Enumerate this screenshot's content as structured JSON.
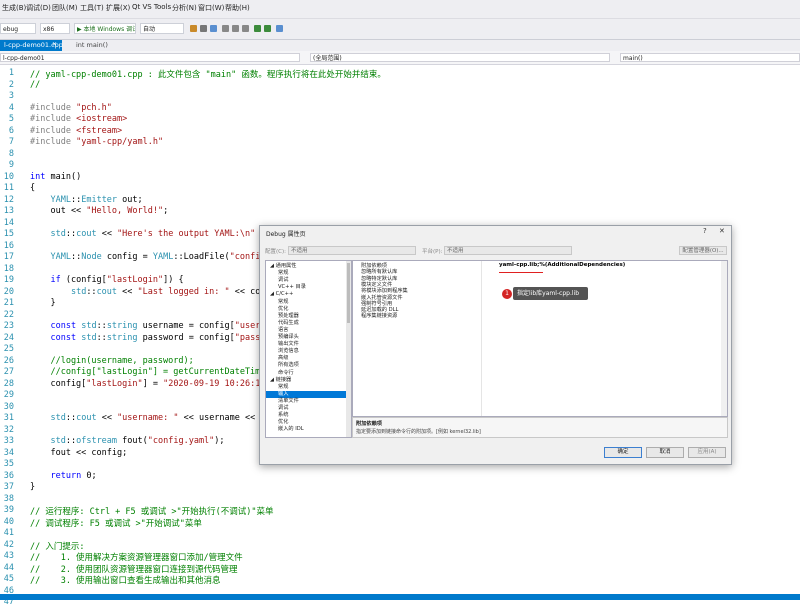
{
  "menu": {
    "items": [
      "生成(B)",
      "调试(D)",
      "团队(M)",
      "工具(T)",
      "扩展(X)",
      "Qt VS Tools",
      "分析(N)",
      "窗口(W)",
      "帮助(H)"
    ]
  },
  "toolbar": {
    "config": "ebug",
    "platform": "x86",
    "debugger": "▶ 本地 Windows 调试器",
    "mode": "自动"
  },
  "tabs": {
    "active": "l-cpp-demo01.cpp",
    "secondary": "int main()"
  },
  "nav": {
    "project": "l-cpp-demo01",
    "scope": "(全局范围)",
    "function": "main()"
  },
  "editor": {
    "line_numbers": [
      "1",
      "2",
      "3",
      "4",
      "5",
      "6",
      "7",
      "8",
      "9",
      "10",
      "11",
      "12",
      "13",
      "14",
      "15",
      "16",
      "17",
      "18",
      "19",
      "20",
      "21",
      "22",
      "23",
      "24",
      "25",
      "26",
      "27",
      "28",
      "29",
      "30",
      "31",
      "32",
      "33",
      "34",
      "35",
      "36",
      "37",
      "38",
      "39",
      "40",
      "41",
      "42",
      "43",
      "44",
      "45",
      "46",
      "47"
    ],
    "lines": [
      "// yaml-cpp-demo01.cpp : 此文件包含 \"main\" 函数。程序执行将在此处开始并结束。",
      "//",
      "",
      "#include \"pch.h\"",
      "#include <iostream>",
      "#include <fstream>",
      "#include \"yaml-cpp/yaml.h\"",
      "",
      "",
      "int main()",
      "{",
      "    YAML::Emitter out;",
      "    out << \"Hello, World!\";",
      "",
      "    std::cout << \"Here's the output YAML:\\n\" << out.c_str();",
      "",
      "    YAML::Node config = YAML::LoadFile(\"config.yaml\");",
      "",
      "    if (config[\"lastLogin\"]) {",
      "        std::cout << \"Last logged in: \" << config[\"lastLogin\"]",
      "    }",
      "",
      "    const std::string username = config[\"username\"].as<std::string>();",
      "    const std::string password = config[\"password\"].as<std::string>();",
      "",
      "    //login(username, password);",
      "    //config[\"lastLogin\"] = getCurrentDateTime();",
      "    config[\"lastLogin\"] = \"2020-09-19 10:26:10\";",
      "",
      "",
      "    std::cout << \"username: \" << username << std::endl;",
      "",
      "    std::ofstream fout(\"config.yaml\");",
      "    fout << config;",
      "",
      "    return 0;",
      "}",
      "",
      "// 运行程序: Ctrl + F5 或调试 >\"开始执行(不调试)\"菜单",
      "// 调试程序: F5 或调试 >\"开始调试\"菜单",
      "",
      "// 入门提示:",
      "//    1. 使用解决方案资源管理器窗口添加/管理文件",
      "//    2. 使用团队资源管理器窗口连接到源代码管理",
      "//    3. 使用输出窗口查看生成输出和其他消息",
      "",
      ""
    ]
  },
  "dialog": {
    "title": "Debug 属性页",
    "help": "?",
    "close": "✕",
    "config_label": "配置(C):",
    "config_value": "不适用",
    "platform_label": "平台(P):",
    "platform_value": "不适用",
    "manager_button": "配置管理器(O)...",
    "tree": [
      "◢ 通用属性",
      "常规",
      "调试",
      "VC++ 目录",
      "◢ C/C++",
      "常规",
      "优化",
      "预处理器",
      "代码生成",
      "语言",
      "预编译头",
      "输出文件",
      "浏览信息",
      "高级",
      "所有选项",
      "命令行",
      "◢ 链接器",
      "常规",
      "输入",
      "清单文件",
      "调试",
      "系统",
      "优化",
      "嵌入的 IDL"
    ],
    "selected_index": 18,
    "grid_rows": [
      "附加依赖项",
      "忽略所有默认库",
      "忽略特定默认库",
      "模块定义文件",
      "将模块添加到程序集",
      "嵌入托管资源文件",
      "强制符号引用",
      "延迟加载的 DLL",
      "程序集链接资源"
    ],
    "grid_value": "yaml-cpp.lib;%(AdditionalDependencies)",
    "callout_number": "1",
    "callout_text": "指定lib库yaml-cpp.lib",
    "desc_title": "附加依赖项",
    "desc_text": "指定要添加到链接命令行的附加项。[例如 kernel32.lib]",
    "ok": "确定",
    "cancel": "取消",
    "apply": "应用(A)"
  },
  "colors": {
    "comment": "#008000",
    "keyword": "#0000ff",
    "string": "#a31515",
    "type": "#2b91af",
    "status": "#007acc",
    "callout": "#d42525"
  }
}
